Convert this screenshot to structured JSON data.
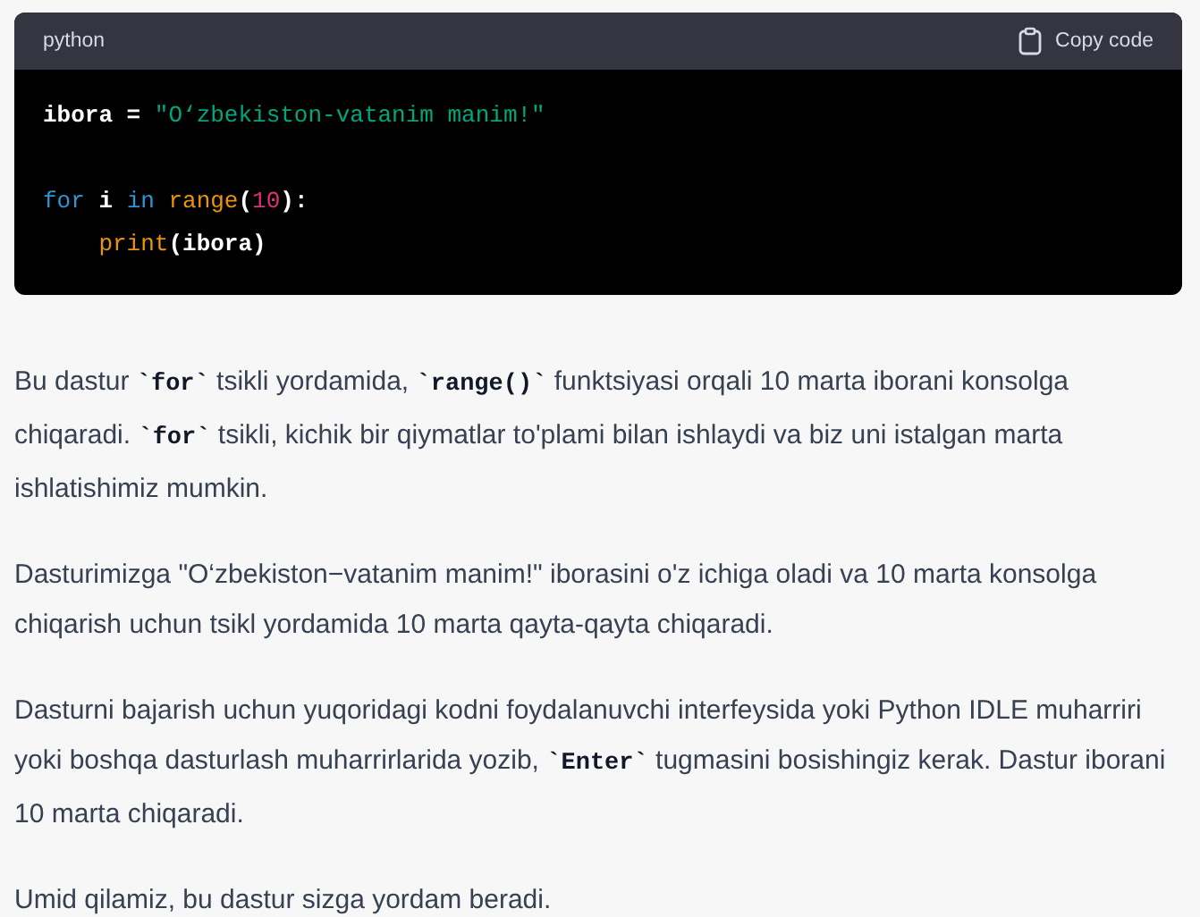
{
  "code_block": {
    "language": "python",
    "copy_label": "Copy code",
    "blocks": [
      [
        {
          "indented": false,
          "tokens": [
            {
              "kind": "plain",
              "text": "ibora = "
            },
            {
              "kind": "string",
              "text": "\"O‘zbekiston-vatanim manim!\""
            }
          ]
        }
      ],
      [
        {
          "indented": false,
          "tokens": [
            {
              "kind": "keyword",
              "text": "for"
            },
            {
              "kind": "plain",
              "text": " i "
            },
            {
              "kind": "keyword",
              "text": "in"
            },
            {
              "kind": "function",
              "text": " range"
            },
            {
              "kind": "plain",
              "text": "("
            },
            {
              "kind": "number",
              "text": "10"
            },
            {
              "kind": "plain",
              "text": "):"
            }
          ]
        },
        {
          "indented": true,
          "tokens": [
            {
              "kind": "function",
              "text": "print"
            },
            {
              "kind": "plain",
              "text": "(ibora)"
            }
          ]
        }
      ]
    ]
  },
  "paragraphs": [
    [
      {
        "kind": "text",
        "text": "Bu dastur "
      },
      {
        "kind": "code",
        "text": "`for`"
      },
      {
        "kind": "text",
        "text": " tsikli yordamida, "
      },
      {
        "kind": "code",
        "text": "`range()`"
      },
      {
        "kind": "text",
        "text": " funktsiyasi orqali 10 marta iborani konsolga chiqaradi. "
      },
      {
        "kind": "code",
        "text": "`for`"
      },
      {
        "kind": "text",
        "text": " tsikli, kichik bir qiymatlar to'plami bilan ishlaydi va biz uni istalgan marta ishlatishimiz mumkin."
      }
    ],
    [
      {
        "kind": "text",
        "text": "Dasturimizga \"O‘zbekiston−vatanim manim!\" iborasini o'z ichiga oladi va 10 marta konsolga chiqarish uchun tsikl yordamida 10 marta qayta-qayta chiqaradi."
      }
    ],
    [
      {
        "kind": "text",
        "text": "Dasturni bajarish uchun yuqoridagi kodni foydalanuvchi interfeysida yoki Python IDLE muharriri yoki boshqa dasturlash muharrirlarida yozib, "
      },
      {
        "kind": "code",
        "text": "`Enter`"
      },
      {
        "kind": "text",
        "text": " tugmasini bosishingiz kerak. Dastur iborani 10 marta chiqaradi."
      }
    ],
    [
      {
        "kind": "text",
        "text": "Umid qilamiz, bu dastur sizga yordam beradi."
      }
    ]
  ]
}
